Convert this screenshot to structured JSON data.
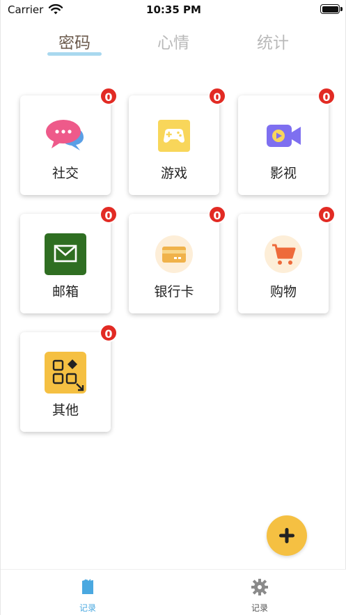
{
  "status_bar": {
    "carrier": "Carrier",
    "time": "10:35 PM"
  },
  "tabs": [
    {
      "label": "密码",
      "active": true
    },
    {
      "label": "心情",
      "active": false
    },
    {
      "label": "统计",
      "active": false
    }
  ],
  "categories": [
    {
      "label": "社交",
      "count": "0",
      "icon": "chat-bubble-icon"
    },
    {
      "label": "游戏",
      "count": "0",
      "icon": "gamepad-icon"
    },
    {
      "label": "影视",
      "count": "0",
      "icon": "video-camera-icon"
    },
    {
      "label": "邮箱",
      "count": "0",
      "icon": "mail-icon"
    },
    {
      "label": "银行卡",
      "count": "0",
      "icon": "bank-card-icon"
    },
    {
      "label": "购物",
      "count": "0",
      "icon": "shopping-cart-icon"
    },
    {
      "label": "其他",
      "count": "0",
      "icon": "apps-icon"
    }
  ],
  "fab": {
    "icon": "plus-icon"
  },
  "bottom_nav": [
    {
      "label": "记录",
      "active": true,
      "icon": "record-icon"
    },
    {
      "label": "记录",
      "active": false,
      "icon": "settings-gear-icon"
    }
  ],
  "colors": {
    "accent": "#a9d8ef",
    "active_tab_text": "#6b5a4c",
    "inactive_tab_text": "#b9b9b9",
    "badge": "#e22b24",
    "fab": "#f5c042",
    "bottom_active": "#4aa8e0",
    "bottom_inactive": "#8a8a8a"
  }
}
